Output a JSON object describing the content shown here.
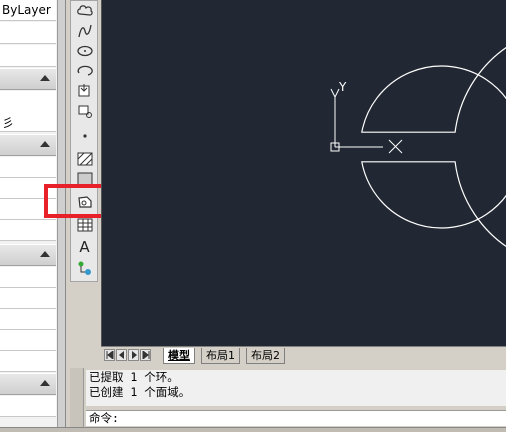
{
  "palette": {
    "layer_value": "ByLayer",
    "partial_value": "彡"
  },
  "toolbar": {
    "tools": [
      {
        "name": "cloud-icon"
      },
      {
        "name": "spline-icon"
      },
      {
        "name": "ellipse-icon"
      },
      {
        "name": "ellipse-arc-icon"
      },
      {
        "name": "insert-block-icon"
      },
      {
        "name": "make-block-icon"
      },
      {
        "name": "point-icon"
      },
      {
        "name": "hatch-icon"
      },
      {
        "name": "region-icon"
      },
      {
        "name": "table-icon"
      },
      {
        "name": "multiline-text-icon",
        "glyph": "A"
      },
      {
        "name": "add-selected-icon"
      }
    ]
  },
  "canvas": {
    "ucs_y_label": "Y",
    "ucs_x_label": "X",
    "colors": {
      "background": "#222833",
      "line": "#ffffff"
    }
  },
  "tabs": {
    "items": [
      {
        "label": "模型",
        "active": true
      },
      {
        "label": "布局1",
        "active": false
      },
      {
        "label": "布局2",
        "active": false
      }
    ]
  },
  "command": {
    "lines": [
      "已提取 1 个环。",
      "已创建 1 个面域。"
    ],
    "prompt": "命令:"
  }
}
